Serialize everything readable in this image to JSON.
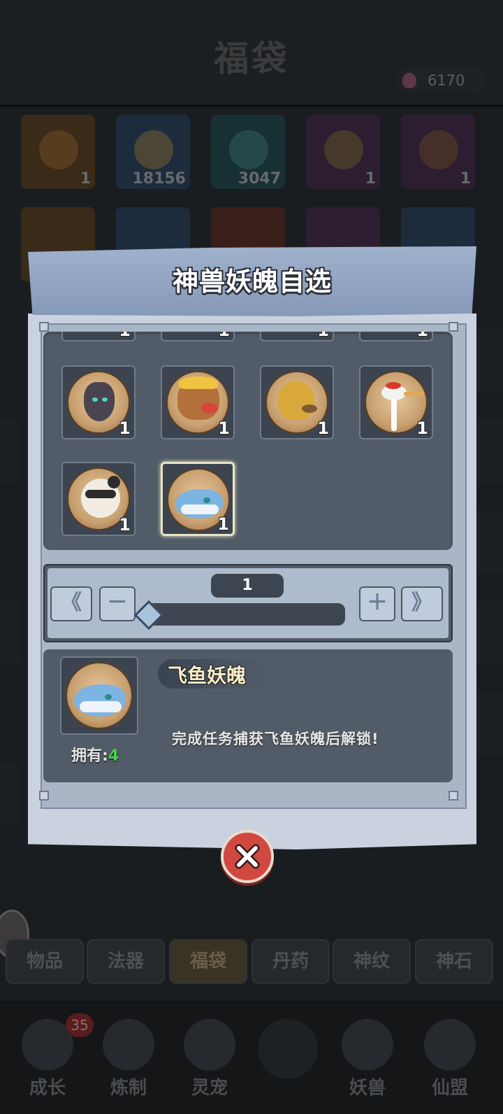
{
  "background": {
    "title": "福袋",
    "currency": "6170",
    "items": [
      {
        "count": "1"
      },
      {
        "count": "18156"
      },
      {
        "count": "3047"
      },
      {
        "count": "1"
      },
      {
        "count": "1"
      }
    ],
    "tabs": [
      "物品",
      "法器",
      "福袋",
      "丹药",
      "神纹",
      "神石"
    ],
    "nav": [
      "成长",
      "炼制",
      "灵宠",
      "",
      "妖兽",
      "仙盟"
    ],
    "nav_badge": "35"
  },
  "dialog": {
    "title": "神兽妖魄自选",
    "slots": [
      {
        "name": "dark-beast-soul",
        "count": "1"
      },
      {
        "name": "golden-dragon-soul",
        "count": "1"
      },
      {
        "name": "golden-eagle-soul",
        "count": "1"
      },
      {
        "name": "crane-soul",
        "count": "1"
      },
      {
        "name": "panda-soul",
        "count": "1"
      },
      {
        "name": "flying-fish-soul",
        "count": "1"
      }
    ],
    "quantity": {
      "value": "1",
      "min_label": "《",
      "minus_label": "－",
      "plus_label": "＋",
      "max_label": "》",
      "slider_fraction": 0
    },
    "detail": {
      "name": "飞鱼妖魄",
      "owned_label": "拥有:",
      "owned_value": "4",
      "description": "完成任务捕获飞鱼妖魄后解锁!"
    }
  },
  "icons": {
    "close": "close-x-icon"
  }
}
